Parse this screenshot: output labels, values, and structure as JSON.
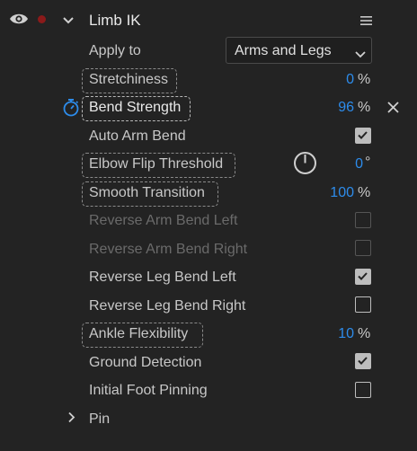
{
  "header": {
    "title": "Limb IK",
    "icons": [
      "eye-icon",
      "record-dot-icon",
      "chevron-down-icon",
      "menu-icon"
    ]
  },
  "apply_to": {
    "label": "Apply to",
    "selected": "Arms and Legs"
  },
  "rows": {
    "stretchiness": {
      "label": "Stretchiness",
      "value": "0",
      "unit": "%"
    },
    "bend_strength": {
      "label": "Bend Strength",
      "value": "96",
      "unit": "%"
    },
    "auto_arm_bend": {
      "label": "Auto Arm Bend",
      "checked": true
    },
    "elbow_flip": {
      "label": "Elbow Flip Threshold",
      "value": "0",
      "unit": "°"
    },
    "smooth_transition": {
      "label": "Smooth Transition",
      "value": "100",
      "unit": "%"
    },
    "reverse_arm_left": {
      "label": "Reverse Arm Bend Left",
      "checked": false,
      "disabled": true
    },
    "reverse_arm_right": {
      "label": "Reverse Arm Bend Right",
      "checked": false,
      "disabled": true
    },
    "reverse_leg_left": {
      "label": "Reverse Leg Bend Left",
      "checked": true
    },
    "reverse_leg_right": {
      "label": "Reverse Leg Bend Right",
      "checked": false
    },
    "ankle_flexibility": {
      "label": "Ankle Flexibility",
      "value": "10",
      "unit": "%"
    },
    "ground_detection": {
      "label": "Ground Detection",
      "checked": true
    },
    "initial_foot_pinning": {
      "label": "Initial Foot Pinning",
      "checked": false
    },
    "pin": {
      "label": "Pin"
    }
  },
  "colors": {
    "background": "#232323",
    "accent_value": "#2d8ceb",
    "record_dot": "#8b1a1a",
    "text": "#c8c8c8",
    "disabled_text": "#6a6a6a"
  }
}
